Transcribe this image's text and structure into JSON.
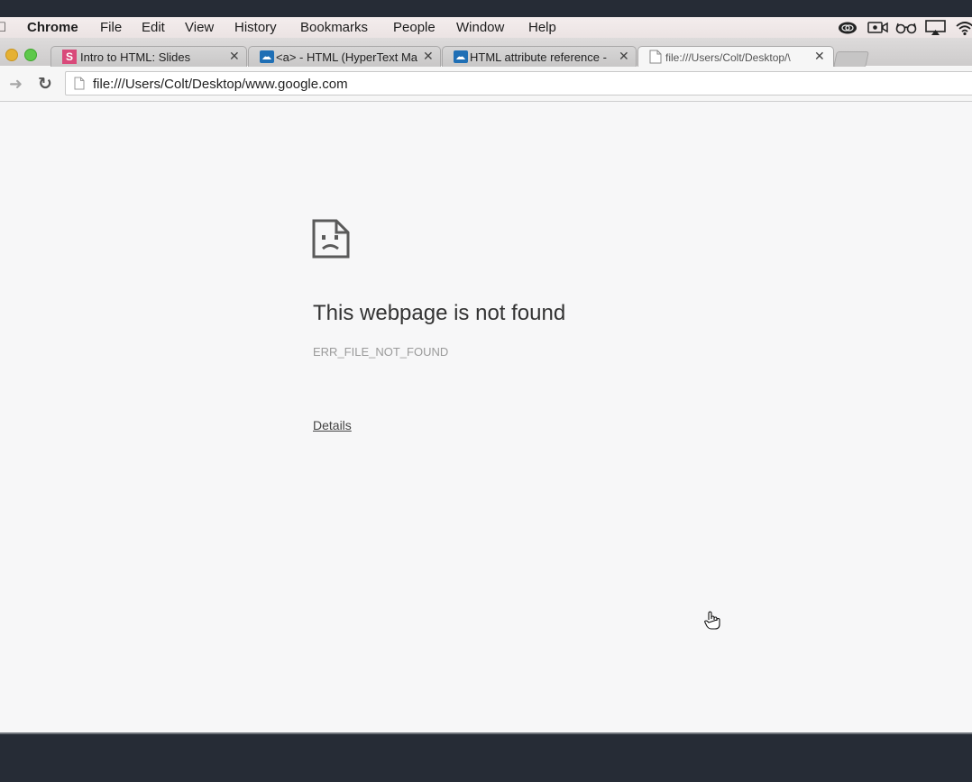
{
  "menubar": {
    "app_name": "Chrome",
    "items": [
      "File",
      "Edit",
      "View",
      "History",
      "Bookmarks",
      "People",
      "Window",
      "Help"
    ],
    "tray_icons": [
      "creative-cloud-icon",
      "facetime-icon",
      "glasses-icon",
      "airplay-icon",
      "wifi-icon"
    ]
  },
  "tabs": [
    {
      "title": "Intro to HTML: Slides",
      "favicon": "slides-icon",
      "favicon_letter": "S",
      "favicon_color": "#d9497a"
    },
    {
      "title": "<a> - HTML (HyperText Ma",
      "favicon": "mdn-icon"
    },
    {
      "title": "HTML attribute reference -",
      "favicon": "mdn-icon"
    },
    {
      "title": "file:///Users/Colt/Desktop/\\",
      "favicon": "page-icon",
      "active": true
    }
  ],
  "toolbar": {
    "url": "file:///Users/Colt/Desktop/www.google.com"
  },
  "error": {
    "title": "This webpage is not found",
    "code": "ERR_FILE_NOT_FOUND",
    "details_link": "Details"
  },
  "colors": {
    "page_bg": "#f7f7f8",
    "desktop_bg": "#262c36",
    "mdn_blue": "#1f6fb5"
  }
}
